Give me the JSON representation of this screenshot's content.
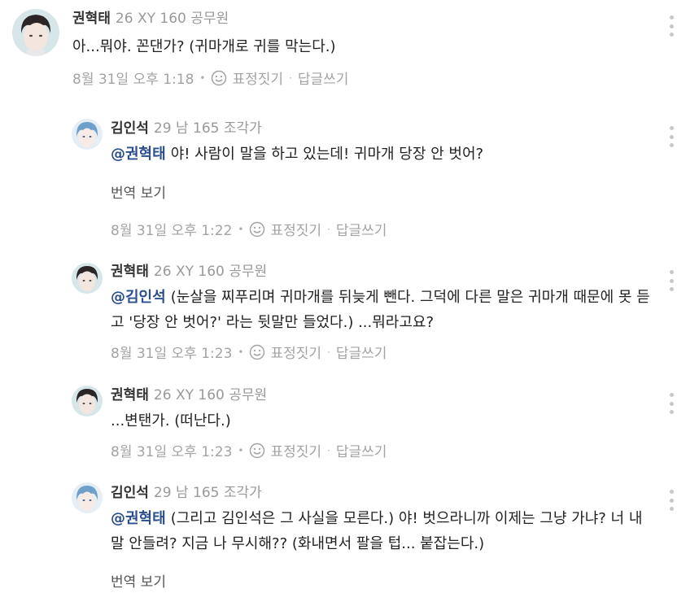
{
  "comments": [
    {
      "author": "권혁태",
      "profile": "26 XY 160 공무원",
      "mention": "",
      "text": "아...뭐야. 꼰댄가? (귀마개로 귀를 막는다.)",
      "translate": "",
      "date": "8월 31일 오후 1:18",
      "react": "표정짓기",
      "reply": "답글쓰기",
      "avatar": "dark-hair-man-avatar"
    },
    {
      "author": "김인석",
      "profile": "29 남 165 조각가",
      "mention": "@권혁태",
      "text": "야! 사람이 말을 하고 있는데! 귀마개 당장 안 벗어?",
      "translate": "번역 보기",
      "date": "8월 31일 오후 1:22",
      "react": "표정짓기",
      "reply": "답글쓰기",
      "avatar": "blue-hair-avatar"
    },
    {
      "author": "권혁태",
      "profile": "26 XY 160 공무원",
      "mention": "@김인석",
      "text": "(눈살을 찌푸리며 귀마개를 뒤늦게 뺀다. 그덕에 다른 말은 귀마개 때문에 못 듣고 '당장 안 벗어?' 라는 뒷말만 들었다.) ...뭐라고요?",
      "translate": "",
      "date": "8월 31일 오후 1:23",
      "react": "표정짓기",
      "reply": "답글쓰기",
      "avatar": "dark-hair-man-avatar"
    },
    {
      "author": "권혁태",
      "profile": "26 XY 160 공무원",
      "mention": "",
      "text": "...변탠가. (떠난다.)",
      "translate": "",
      "date": "8월 31일 오후 1:23",
      "react": "표정짓기",
      "reply": "답글쓰기",
      "avatar": "dark-hair-man-avatar"
    },
    {
      "author": "김인석",
      "profile": "29 남 165 조각가",
      "mention": "@권혁태",
      "text": "(그리고 김인석은 그 사실을 모른다.) 야! 벗으라니까 이제는 그냥 가냐? 너 내 말 안들려? 지금 나 무시해?? (화내면서 팔을 텁... 붙잡는다.)",
      "translate": "번역 보기",
      "date": "",
      "react": "",
      "reply": "",
      "avatar": "blue-hair-avatar"
    }
  ],
  "colors": {
    "mention": "#2b4f8e",
    "meta": "#999999",
    "footer": "#a3a3a3",
    "more_dots": "#c8c8c8"
  },
  "icons": {
    "emoji": "smile-face-icon",
    "more": "more-vertical-icon"
  }
}
